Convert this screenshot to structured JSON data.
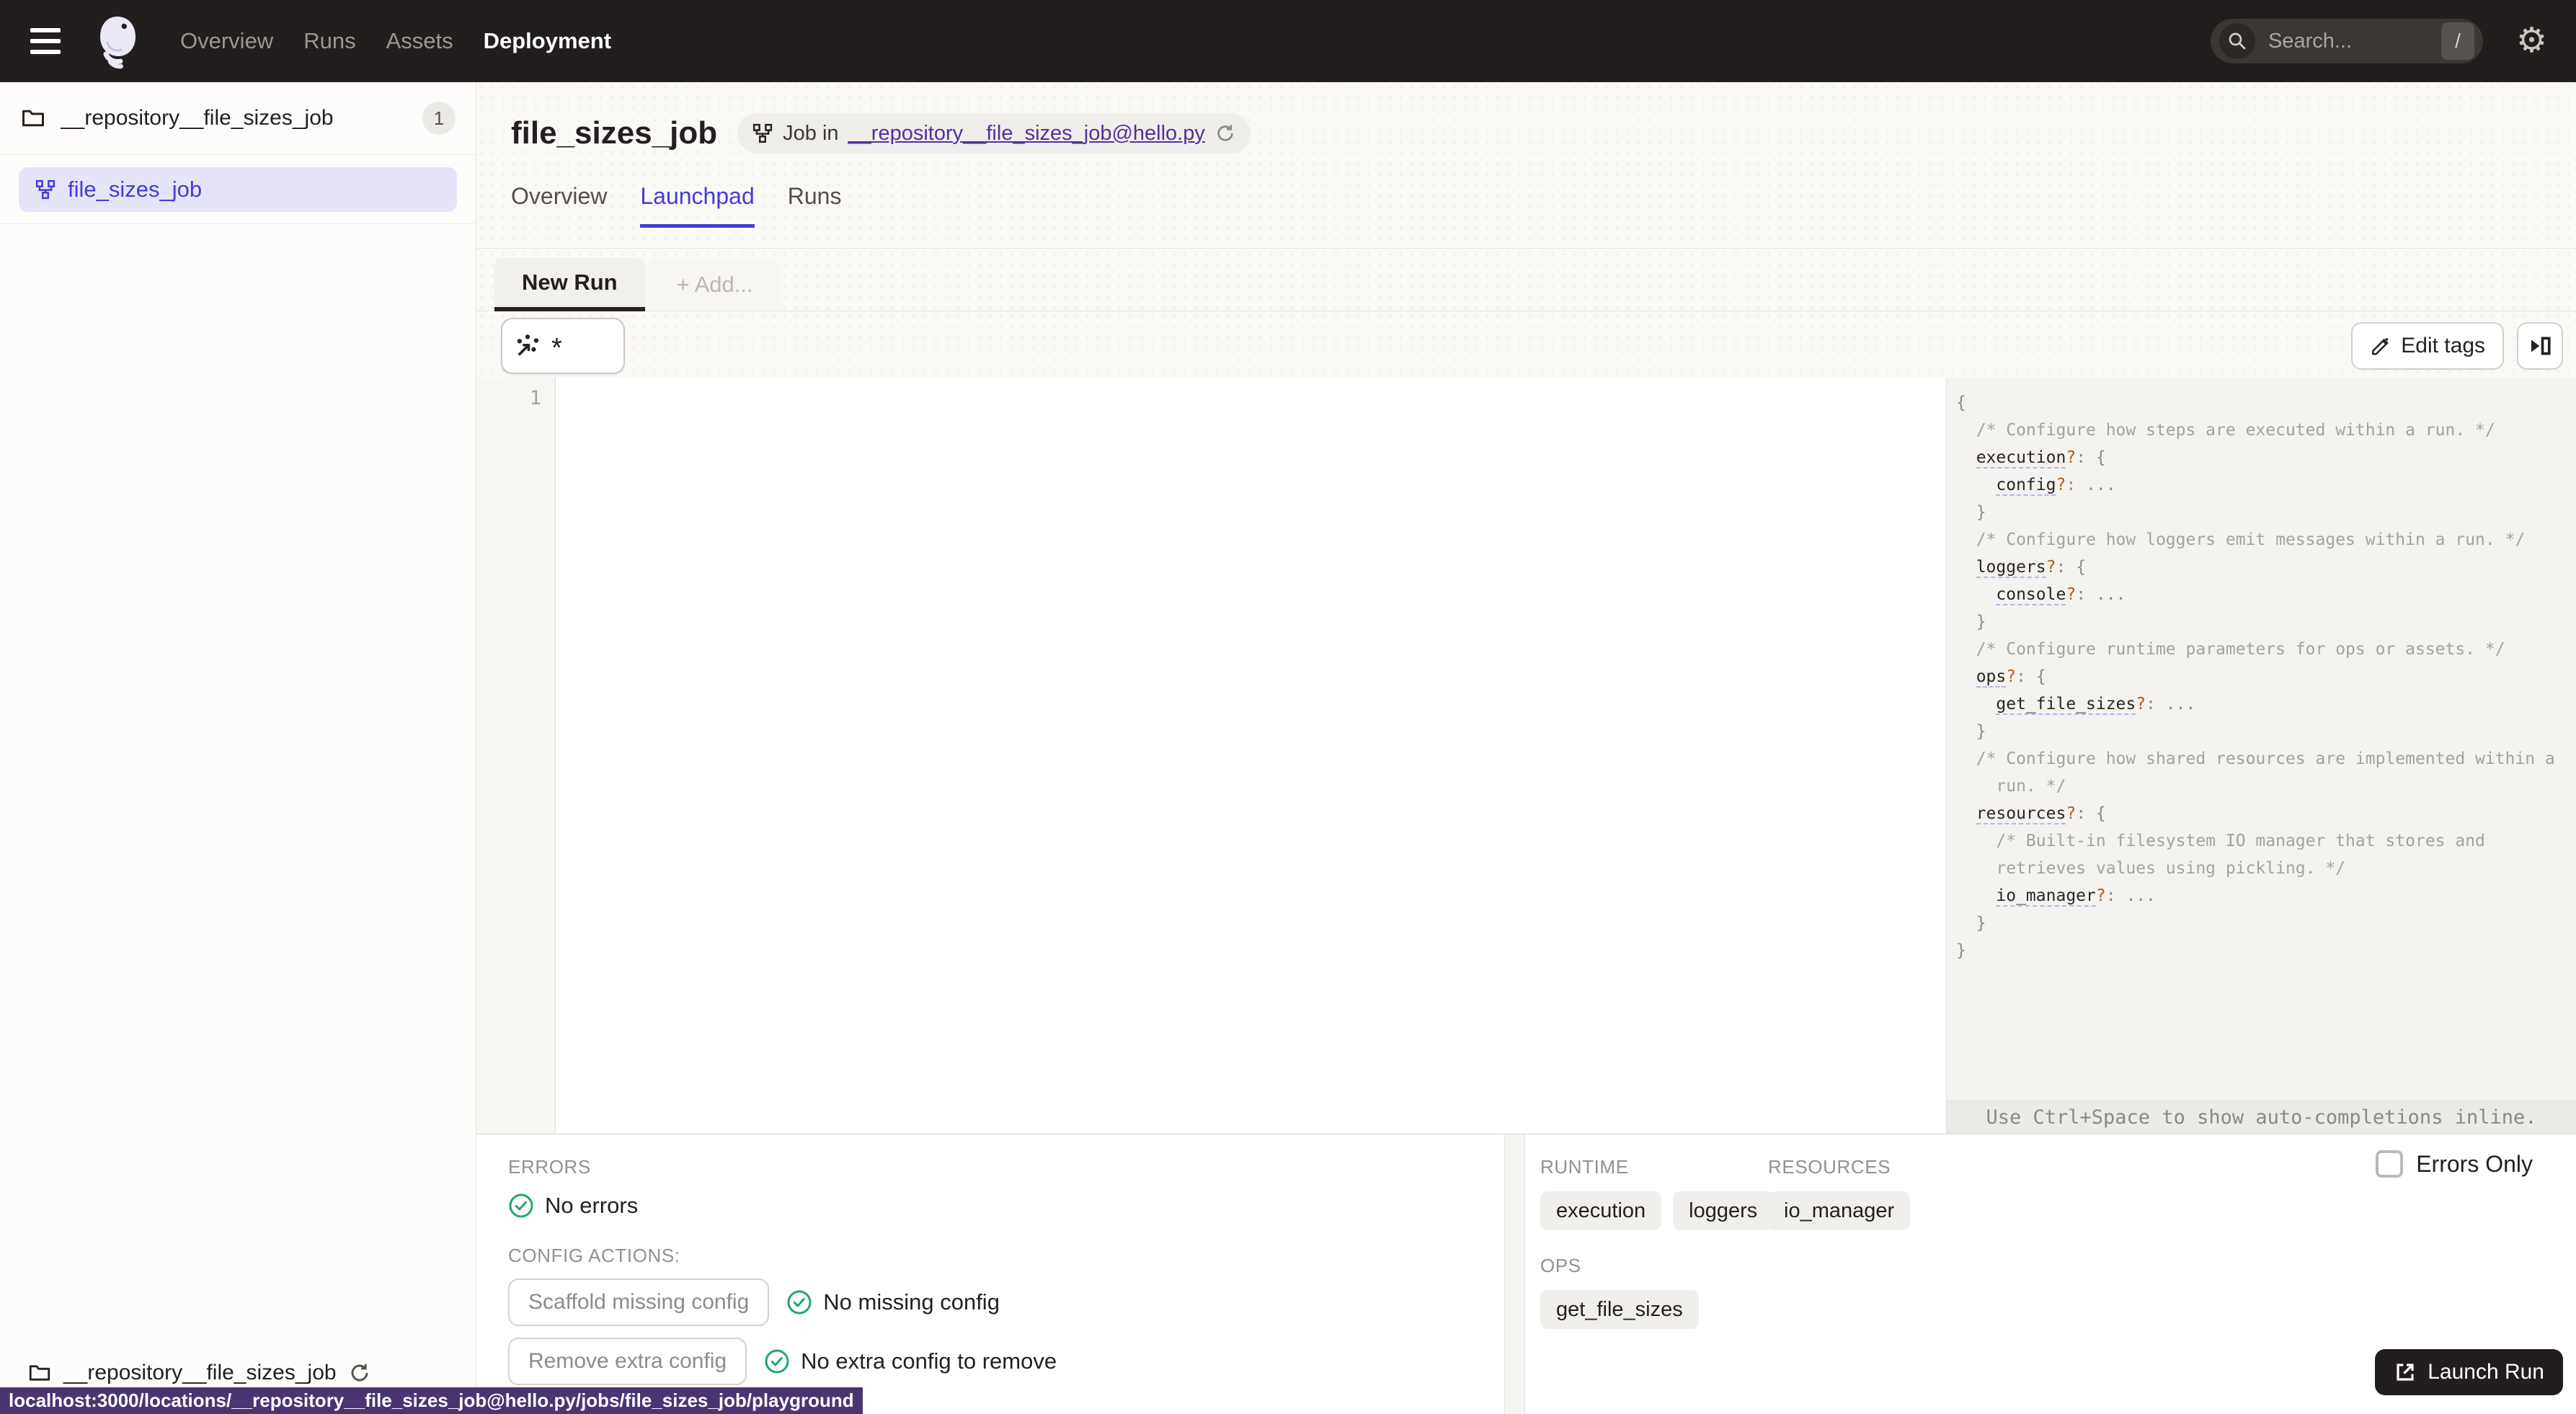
{
  "colors": {
    "accent": "#433CD8",
    "link": "#52309D",
    "success": "#1FA966",
    "nav_bg": "#211E1D",
    "tooltip_bg": "#4A3572"
  },
  "nav": {
    "items": [
      {
        "label": "Overview",
        "active": false
      },
      {
        "label": "Runs",
        "active": false
      },
      {
        "label": "Assets",
        "active": false
      },
      {
        "label": "Deployment",
        "active": true
      }
    ],
    "search": {
      "placeholder": "Search...",
      "shortcut": "/"
    },
    "icons": {
      "menu": "hamburger",
      "logo": "dagster-octopus",
      "search": "magnifier",
      "settings": "gear"
    }
  },
  "sidebar": {
    "repo": {
      "name": "__repository__file_sizes_job",
      "count": "1"
    },
    "items": [
      {
        "label": "file_sizes_job",
        "selected": true,
        "icon": "job-graph"
      }
    ],
    "footer": {
      "name": "__repository__file_sizes_job",
      "icon": "folder"
    }
  },
  "header": {
    "title": "file_sizes_job",
    "badge": {
      "prefix": "Job in ",
      "link": "__repository__file_sizes_job@hello.py",
      "icon": "job-graph"
    },
    "tabs": [
      {
        "label": "Overview",
        "active": false
      },
      {
        "label": "Launchpad",
        "active": true
      },
      {
        "label": "Runs",
        "active": false
      }
    ]
  },
  "launchpad": {
    "run_tabs": [
      {
        "label": "New Run",
        "active": true
      },
      {
        "label": "+ Add...",
        "active": false
      }
    ],
    "op_selector_value": "*",
    "edit_tags_label": "Edit tags",
    "gutter_lines": [
      "1"
    ],
    "hint": "Use Ctrl+Space to show auto-completions inline.",
    "schema_lines": [
      [
        [
          "b",
          "{"
        ]
      ],
      [
        [
          "c",
          "  /* Configure how steps are executed within a run. */"
        ]
      ],
      [
        [
          "t",
          "  "
        ],
        [
          "k",
          "execution"
        ],
        [
          "q",
          "?"
        ],
        [
          "p",
          ": "
        ],
        [
          "b",
          "{"
        ]
      ],
      [
        [
          "t",
          "    "
        ],
        [
          "k",
          "config"
        ],
        [
          "q",
          "?"
        ],
        [
          "p",
          ": "
        ],
        [
          "e",
          "..."
        ]
      ],
      [
        [
          "t",
          "  "
        ],
        [
          "b",
          "}"
        ]
      ],
      [
        [
          "c",
          "  /* Configure how loggers emit messages within a run. */"
        ]
      ],
      [
        [
          "t",
          "  "
        ],
        [
          "k",
          "loggers"
        ],
        [
          "q",
          "?"
        ],
        [
          "p",
          ": "
        ],
        [
          "b",
          "{"
        ]
      ],
      [
        [
          "t",
          "    "
        ],
        [
          "k",
          "console"
        ],
        [
          "q",
          "?"
        ],
        [
          "p",
          ": "
        ],
        [
          "e",
          "..."
        ]
      ],
      [
        [
          "t",
          "  "
        ],
        [
          "b",
          "}"
        ]
      ],
      [
        [
          "c",
          "  /* Configure runtime parameters for ops or assets. */"
        ]
      ],
      [
        [
          "t",
          "  "
        ],
        [
          "k",
          "ops"
        ],
        [
          "q",
          "?"
        ],
        [
          "p",
          ": "
        ],
        [
          "b",
          "{"
        ]
      ],
      [
        [
          "t",
          "    "
        ],
        [
          "k",
          "get_file_sizes"
        ],
        [
          "q",
          "?"
        ],
        [
          "p",
          ": "
        ],
        [
          "e",
          "..."
        ]
      ],
      [
        [
          "t",
          "  "
        ],
        [
          "b",
          "}"
        ]
      ],
      [
        [
          "c",
          "  /* Configure how shared resources are implemented within a"
        ]
      ],
      [
        [
          "c",
          "    run. */"
        ]
      ],
      [
        [
          "t",
          "  "
        ],
        [
          "k",
          "resources"
        ],
        [
          "q",
          "?"
        ],
        [
          "p",
          ": "
        ],
        [
          "b",
          "{"
        ]
      ],
      [
        [
          "c",
          "    /* Built-in filesystem IO manager that stores and"
        ]
      ],
      [
        [
          "c",
          "    retrieves values using pickling. */"
        ]
      ],
      [
        [
          "t",
          "    "
        ],
        [
          "k",
          "io_manager"
        ],
        [
          "q",
          "?"
        ],
        [
          "p",
          ": "
        ],
        [
          "e",
          "..."
        ]
      ],
      [
        [
          "t",
          "  "
        ],
        [
          "b",
          "}"
        ]
      ],
      [
        [
          "b",
          "}"
        ]
      ]
    ]
  },
  "footer_panel": {
    "errors_title": "ERRORS",
    "no_errors": "No errors",
    "config_actions_title": "CONFIG ACTIONS:",
    "actions": [
      {
        "button": "Scaffold missing config",
        "status": "No missing config"
      },
      {
        "button": "Remove extra config",
        "status": "No extra config to remove"
      }
    ],
    "errors_only_label": "Errors Only",
    "errors_only_checked": false,
    "groups": [
      {
        "title": "RUNTIME",
        "tags": [
          "execution",
          "loggers"
        ]
      },
      {
        "title": "RESOURCES",
        "tags": [
          "io_manager"
        ]
      },
      {
        "title": "OPS",
        "tags": [
          "get_file_sizes"
        ]
      }
    ],
    "launch_label": "Launch Run",
    "launch_icon": "launch-external"
  },
  "status_tooltip": "localhost:3000/locations/__repository__file_sizes_job@hello.py/jobs/file_sizes_job/playground"
}
